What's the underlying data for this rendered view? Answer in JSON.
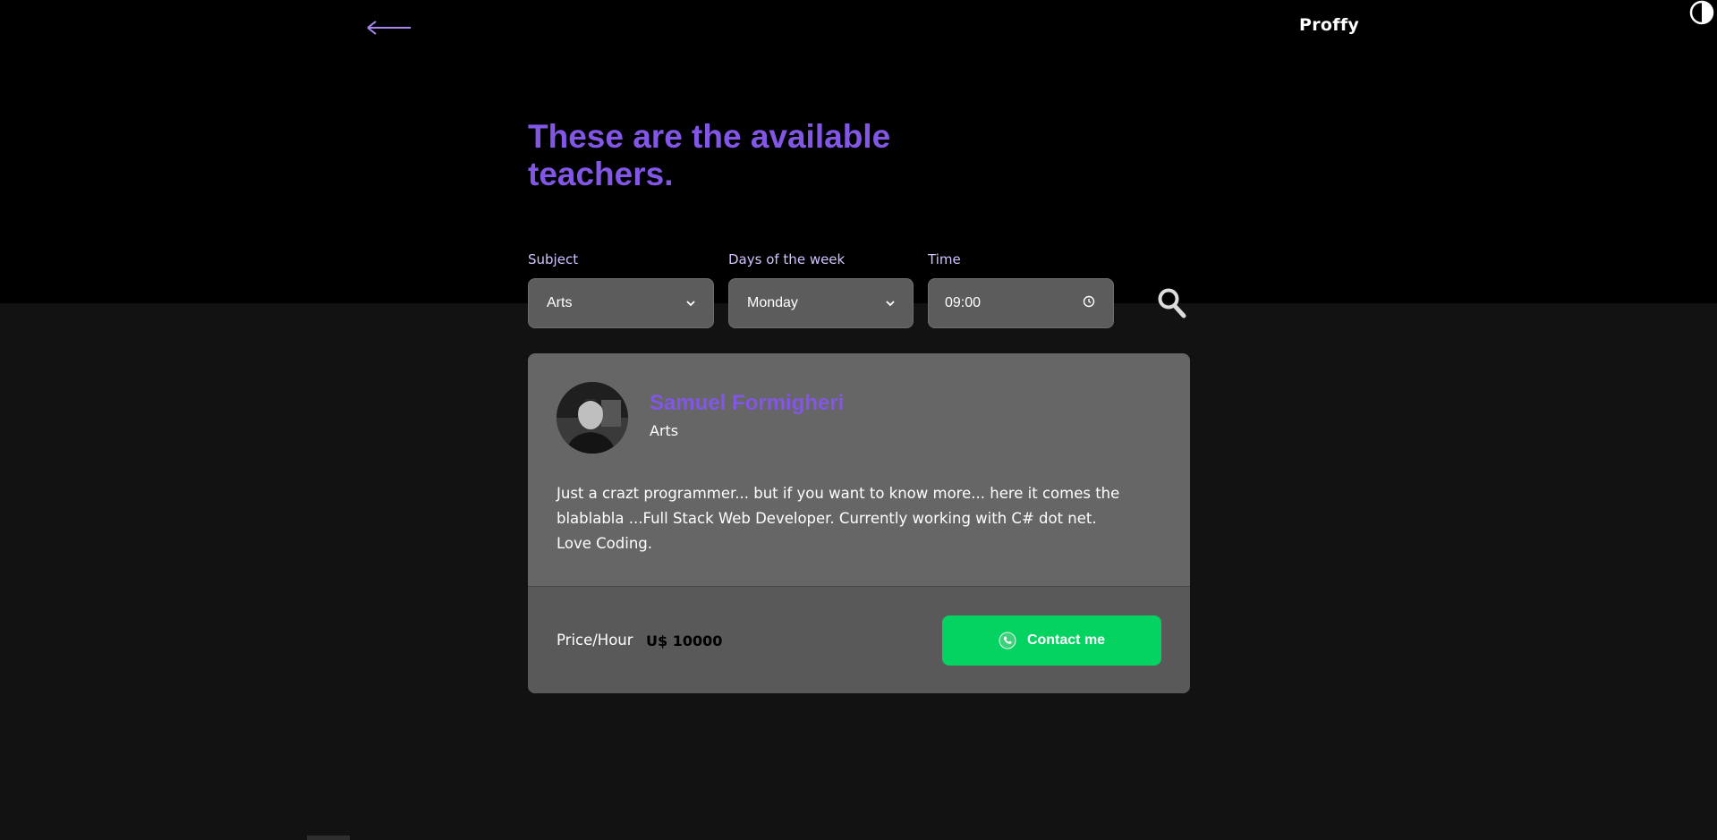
{
  "header": {
    "back_icon": "arrow-left-icon",
    "logo": "Proffy",
    "theme_icon": "half-circle-contrast-icon"
  },
  "page": {
    "title": "These are the available teachers."
  },
  "filters": {
    "subject": {
      "label": "Subject",
      "value": "Arts"
    },
    "week_day": {
      "label": "Days of the week",
      "value": "Monday"
    },
    "time": {
      "label": "Time",
      "value": "09:00"
    },
    "search_icon": "search-icon"
  },
  "teacher": {
    "name": "Samuel Formigheri",
    "subject": "Arts",
    "bio": "Just a crazt programmer... but if you want to know more... here it comes the blablabla ...Full Stack Web Developer. Currently working with C# dot net. Love Coding.",
    "price_label": "Price/Hour",
    "price_value": "U$ 10000",
    "contact_label": "Contact me",
    "contact_icon": "whatsapp-icon"
  },
  "colors": {
    "accent": "#8257e5",
    "header_bg": "#000000",
    "page_bg": "#121212",
    "card_bg": "#666666",
    "card_footer_bg": "#595959",
    "contact_button": "#04d361"
  }
}
